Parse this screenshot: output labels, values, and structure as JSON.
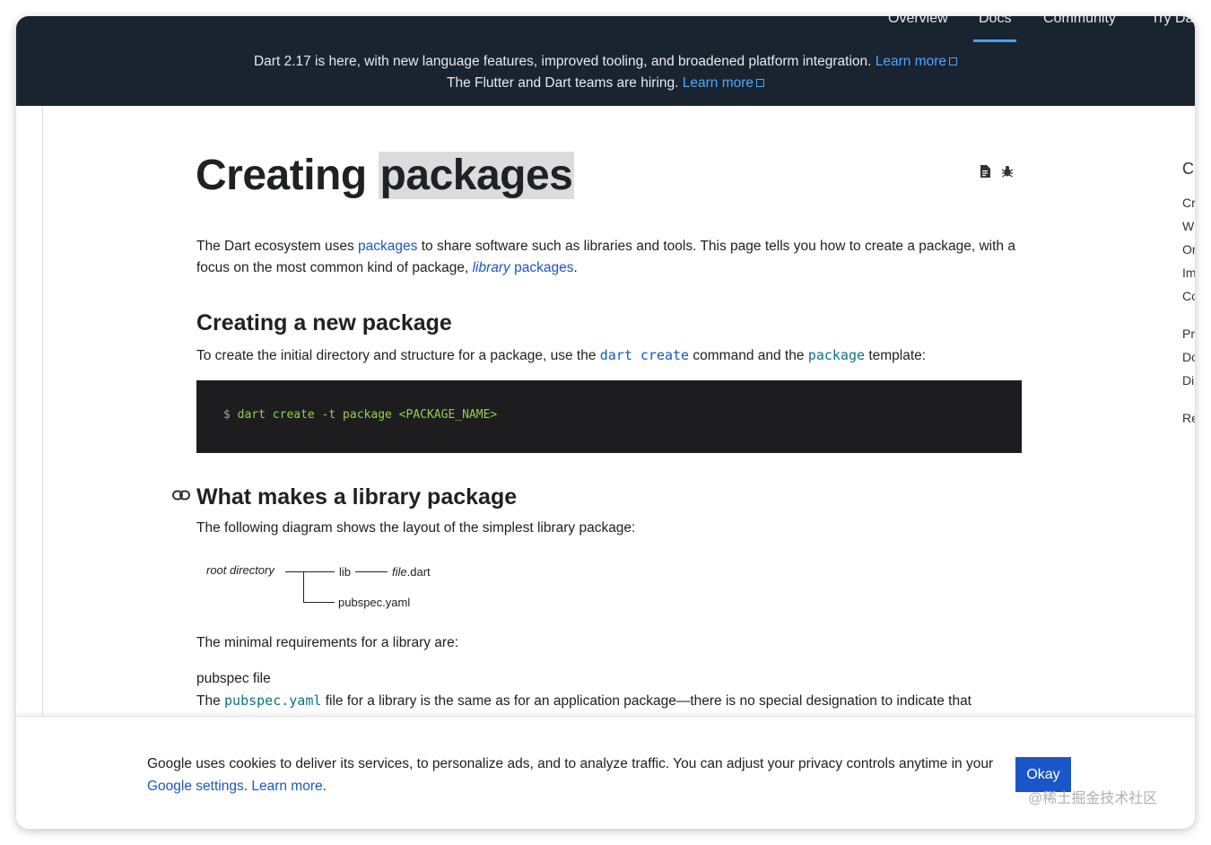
{
  "nav": {
    "items": [
      {
        "label": "Overview",
        "active": false
      },
      {
        "label": "Docs",
        "active": true
      },
      {
        "label": "Community",
        "active": false
      },
      {
        "label": "Try Da",
        "active": false
      }
    ]
  },
  "banner": {
    "line1_text": "Dart 2.17 is here, with new language features, improved tooling, and broadened platform integration.",
    "line1_link": "Learn more",
    "line2_text": "The Flutter and Dart teams are hiring.",
    "line2_link": "Learn more"
  },
  "page": {
    "title_part1": "Creating",
    "title_part2": "packages",
    "intro_1": "The Dart ecosystem uses ",
    "intro_link_packages": "packages",
    "intro_2": " to share software such as libraries and tools. This page tells you how to create a package, with a focus on the most common kind of package, ",
    "intro_link_library": "library",
    "intro_link_packages2": " packages",
    "intro_3": ".",
    "section1_heading": "Creating a new package",
    "section1_text_1": "To create the initial directory and structure for a package, use the ",
    "section1_code_dart_create": "dart create",
    "section1_text_2": " command and the ",
    "section1_code_package": "package",
    "section1_text_3": " template:",
    "code_prompt": "$",
    "code_command": " dart create -t package <PACKAGE_NAME>",
    "section2_heading": "What makes a library package",
    "section2_text": "The following diagram shows the layout of the simplest library package:",
    "diagram": {
      "root": "root directory",
      "lib": "lib",
      "file_italic": "file",
      "file_ext": ".dart",
      "pubspec": "pubspec.yaml"
    },
    "requirements_text": "The minimal requirements for a library are:",
    "pubspec_heading": "pubspec file",
    "pubspec_text_1": "The ",
    "pubspec_code": "pubspec.yaml",
    "pubspec_text_2": " file for a library is the same as for an application package—there is no special designation to indicate that"
  },
  "toc": [
    "C",
    "Cr",
    "W",
    "Or",
    "Im",
    "Co",
    "Pr",
    "Do",
    "Di",
    "Re"
  ],
  "cookie": {
    "text": "Google uses cookies to deliver its services, to personalize ads, and to analyze traffic. You can adjust your privacy controls anytime in your ",
    "link_settings": "Google settings",
    "sep": ". ",
    "link_learn": "Learn more",
    "end": ".",
    "button": "Okay"
  },
  "watermark": "@稀土掘金技术社区",
  "colors": {
    "banner_bg": "#1a2330",
    "link": "#1a56c9",
    "code_bg": "#1d1d1f",
    "code_green": "#8fd14f",
    "button_bg": "#1a56c9"
  }
}
